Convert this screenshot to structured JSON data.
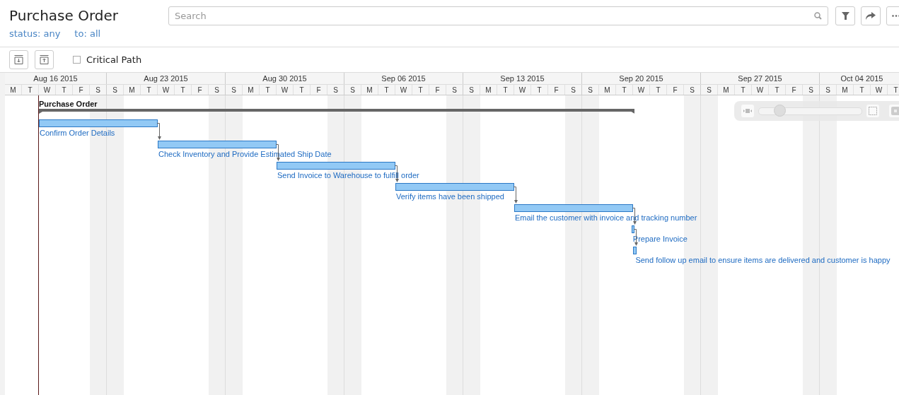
{
  "title": "Purchase Order",
  "search": {
    "placeholder": "Search"
  },
  "filters": [
    "status: any",
    "to: all"
  ],
  "critical_path": {
    "label": "Critical Path",
    "checked": false
  },
  "weeks": [
    {
      "label": "Aug 16 2015",
      "days": [
        {
          "d": "M",
          "weekend": false
        },
        {
          "d": "T",
          "weekend": false
        },
        {
          "d": "W",
          "weekend": false
        },
        {
          "d": "T",
          "weekend": false
        },
        {
          "d": "F",
          "weekend": false
        },
        {
          "d": "S",
          "weekend": true
        }
      ]
    },
    {
      "label": "Aug 23 2015",
      "days": [
        {
          "d": "S",
          "weekend": true
        },
        {
          "d": "M",
          "weekend": false
        },
        {
          "d": "T",
          "weekend": false
        },
        {
          "d": "W",
          "weekend": false
        },
        {
          "d": "T",
          "weekend": false
        },
        {
          "d": "F",
          "weekend": false
        },
        {
          "d": "S",
          "weekend": true
        }
      ]
    },
    {
      "label": "Aug 30 2015",
      "days": [
        {
          "d": "S",
          "weekend": true
        },
        {
          "d": "M",
          "weekend": false
        },
        {
          "d": "T",
          "weekend": false
        },
        {
          "d": "W",
          "weekend": false
        },
        {
          "d": "T",
          "weekend": false
        },
        {
          "d": "F",
          "weekend": false
        },
        {
          "d": "S",
          "weekend": true
        }
      ]
    },
    {
      "label": "Sep 06 2015",
      "days": [
        {
          "d": "S",
          "weekend": true
        },
        {
          "d": "M",
          "weekend": false
        },
        {
          "d": "T",
          "weekend": false
        },
        {
          "d": "W",
          "weekend": false
        },
        {
          "d": "T",
          "weekend": false
        },
        {
          "d": "F",
          "weekend": false
        },
        {
          "d": "S",
          "weekend": true
        }
      ]
    },
    {
      "label": "Sep 13 2015",
      "days": [
        {
          "d": "S",
          "weekend": true
        },
        {
          "d": "M",
          "weekend": false
        },
        {
          "d": "T",
          "weekend": false
        },
        {
          "d": "W",
          "weekend": false
        },
        {
          "d": "T",
          "weekend": false
        },
        {
          "d": "F",
          "weekend": false
        },
        {
          "d": "S",
          "weekend": true
        }
      ]
    },
    {
      "label": "Sep 20 2015",
      "days": [
        {
          "d": "S",
          "weekend": true
        },
        {
          "d": "M",
          "weekend": false
        },
        {
          "d": "T",
          "weekend": false
        },
        {
          "d": "W",
          "weekend": false
        },
        {
          "d": "T",
          "weekend": false
        },
        {
          "d": "F",
          "weekend": false
        },
        {
          "d": "S",
          "weekend": true
        }
      ]
    },
    {
      "label": "Sep 27 2015",
      "days": [
        {
          "d": "S",
          "weekend": true
        },
        {
          "d": "M",
          "weekend": false
        },
        {
          "d": "T",
          "weekend": false
        },
        {
          "d": "W",
          "weekend": false
        },
        {
          "d": "T",
          "weekend": false
        },
        {
          "d": "F",
          "weekend": false
        },
        {
          "d": "S",
          "weekend": true
        }
      ]
    },
    {
      "label": "Oct 04 2015",
      "days": [
        {
          "d": "S",
          "weekend": true
        },
        {
          "d": "M",
          "weekend": false
        },
        {
          "d": "T",
          "weekend": false
        },
        {
          "d": "W",
          "weekend": false
        },
        {
          "d": "T",
          "weekend": false
        }
      ]
    }
  ],
  "project": {
    "name": "Purchase Order"
  },
  "tasks": [
    {
      "name": "Confirm Order Details"
    },
    {
      "name": "Check Inventory and Provide Estimated Ship Date"
    },
    {
      "name": "Send Invoice to Warehouse to fulfill order"
    },
    {
      "name": "Verify items have been shipped"
    },
    {
      "name": "Email the customer with invoice and tracking number"
    },
    {
      "name": "Prepare Invoice"
    },
    {
      "name": "Send follow up email to ensure items are delivered and customer is happy"
    }
  ],
  "zoom": {
    "level": 0.2
  }
}
